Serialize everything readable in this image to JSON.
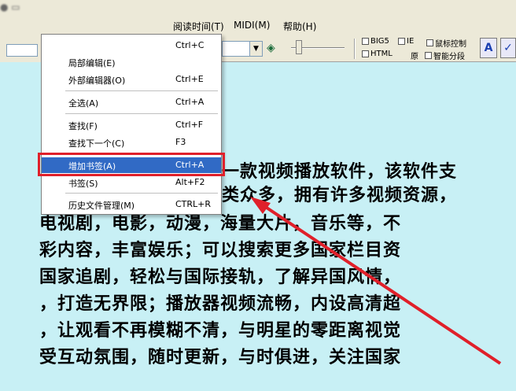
{
  "menubar": {
    "items": [
      "阅读时间(T)",
      "MIDI(M)",
      "帮助(H)"
    ]
  },
  "toolbar": {
    "checkboxes": [
      "BIG5",
      "IE",
      "鼠标控制",
      "HTML",
      "原",
      "智能分段"
    ],
    "buttons": [
      "A",
      "✓"
    ]
  },
  "context_menu": {
    "items": [
      {
        "label": "",
        "shortcut": "Ctrl+C"
      },
      {
        "label": "局部编辑(E)",
        "shortcut": ""
      },
      {
        "label": "外部编辑器(O)",
        "shortcut": "Ctrl+E"
      },
      {
        "label": "全选(A)",
        "shortcut": "Ctrl+A"
      },
      {
        "label": "查找(F)",
        "shortcut": "Ctrl+F"
      },
      {
        "label": "查找下一个(C)",
        "shortcut": "F3"
      },
      {
        "label": "增加书签(A)",
        "shortcut": "Ctrl+A"
      },
      {
        "label": "书签(S)",
        "shortcut": "Alt+F2"
      },
      {
        "label": "历史文件管理(M)",
        "shortcut": "CTRL+R"
      }
    ]
  },
  "content": {
    "lines": [
      "一款视频播放软件，该软件支",
      "类众多，拥有许多视频资源，",
      "电视剧，电影，动漫，海量大片，音乐等，不",
      "彩内容，丰富娱乐；可以搜索更多国家栏目资",
      "国家追剧，轻松与国际接轨，了解异国风情，",
      "，打造无界限；播放器视频流畅，内设高清超",
      "，让观看不再模糊不清，与明星的零距离视觉",
      "受互动氛围，随时更新，与时俱进，关注国家"
    ]
  },
  "colors": {
    "highlight": "#316ac5",
    "annotation_red": "#e0202a",
    "content_bg": "#c8f0f5"
  }
}
